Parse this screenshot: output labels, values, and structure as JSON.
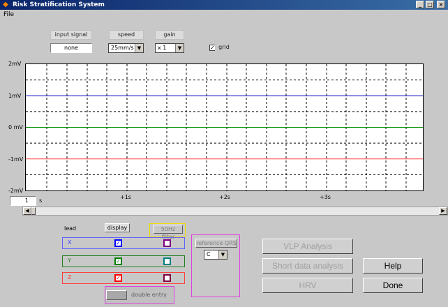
{
  "window": {
    "title": "Risk Stratification System",
    "controls": {
      "minimize": "_",
      "maximize": "□",
      "close": "×"
    }
  },
  "menu": {
    "file": "File"
  },
  "controls": {
    "input_signal": {
      "label": "input signal",
      "value": "none"
    },
    "speed": {
      "label": "speed",
      "value": "25mm/s"
    },
    "gain": {
      "label": "gain",
      "value": "x 1"
    },
    "grid": {
      "label": "grid",
      "checked": true
    }
  },
  "plot": {
    "y_ticks": [
      "2mV",
      "1mV",
      "0 mV",
      "-1mV",
      "-2mV"
    ],
    "x_ticks": [
      "+1s",
      "+2s",
      "+3s"
    ],
    "grid": true,
    "lines": [
      {
        "name": "X",
        "color": "#0000c0",
        "level_mV": 1
      },
      {
        "name": "Y",
        "color": "#009000",
        "level_mV": 0
      },
      {
        "name": "Z",
        "color": "#ff4040",
        "level_mV": -1
      }
    ]
  },
  "scroll": {
    "window_seconds": "1",
    "unit": "s"
  },
  "lead_table": {
    "header_lead": "lead",
    "header_display": "display",
    "header_filter": "50Hz filter",
    "rows": [
      {
        "name": "X",
        "color": "#0000ff",
        "display_color": "#0000ff",
        "filter_color": "#800080"
      },
      {
        "name": "Y",
        "color": "#008000",
        "display_color": "#008000",
        "filter_color": "#008080"
      },
      {
        "name": "Z",
        "color": "#ff0000",
        "display_color": "#ff0000",
        "filter_color": "#800040"
      }
    ]
  },
  "reference_qrs": {
    "label": "reference QRS",
    "value": "C"
  },
  "buttons": {
    "vlp": "VLP Analysis",
    "short": "Short data analysis",
    "hrv": "HRV",
    "help": "Help",
    "done": "Done",
    "bottom": "double entry"
  }
}
